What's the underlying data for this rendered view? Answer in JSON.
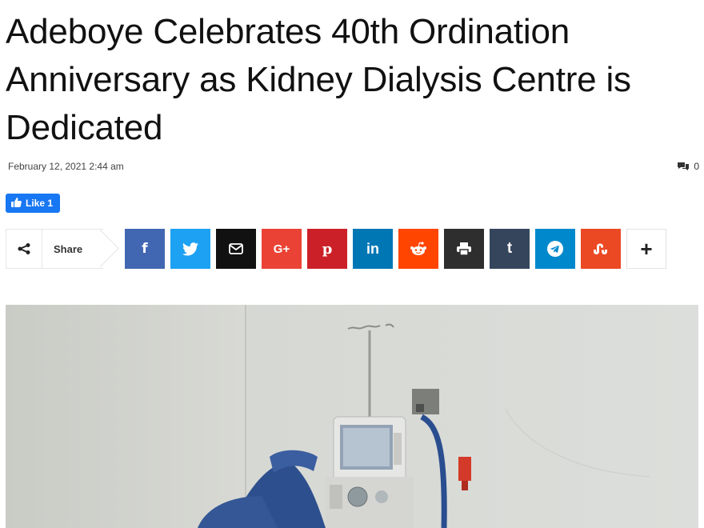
{
  "article": {
    "title": "Adeboye Celebrates 40th Ordination Anniversary as Kidney Dialysis Centre is Dedicated",
    "date": "February 12, 2021 2:44 am",
    "comments_count": "0"
  },
  "facebook": {
    "like_label": "Like 1"
  },
  "share": {
    "label": "Share",
    "buttons": [
      {
        "icon": "facebook-icon",
        "glyph": "f",
        "color": "#4267b2"
      },
      {
        "icon": "twitter-icon",
        "glyph": "",
        "color": "#1da1f2"
      },
      {
        "icon": "email-icon",
        "glyph": "",
        "color": "#111111"
      },
      {
        "icon": "google-plus-icon",
        "glyph": "G+",
        "color": "#ea4335"
      },
      {
        "icon": "pinterest-icon",
        "glyph": "p",
        "color": "#cb2027"
      },
      {
        "icon": "linkedin-icon",
        "glyph": "in",
        "color": "#0077b5"
      },
      {
        "icon": "reddit-icon",
        "glyph": "",
        "color": "#ff4500"
      },
      {
        "icon": "print-icon",
        "glyph": "",
        "color": "#2e2e2e"
      },
      {
        "icon": "tumblr-icon",
        "glyph": "t",
        "color": "#35465c"
      },
      {
        "icon": "telegram-icon",
        "glyph": "",
        "color": "#0088cc"
      },
      {
        "icon": "stumbleupon-icon",
        "glyph": "",
        "color": "#eb4924"
      },
      {
        "icon": "more-icon",
        "glyph": "+",
        "color": "#ffffff"
      }
    ]
  },
  "image": {
    "subject": "dialysis-machine-photo"
  }
}
